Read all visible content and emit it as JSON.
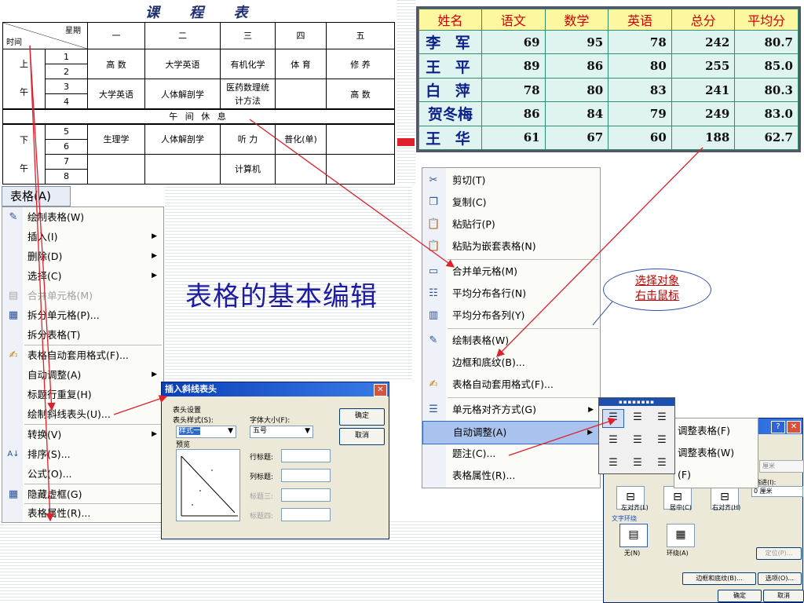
{
  "schedule": {
    "title": "课 程 表",
    "corner_top": "星期",
    "corner_bottom": "时间",
    "days": [
      "一",
      "二",
      "三",
      "四",
      "五"
    ],
    "morning_label": [
      "上",
      "午"
    ],
    "afternoon_label": [
      "下",
      "午"
    ],
    "periods": [
      "1",
      "2",
      "3",
      "4",
      "5",
      "6",
      "7",
      "8"
    ],
    "morning_rows": [
      [
        "高 数",
        "大学英语",
        "有机化学",
        "体 育",
        "修 养"
      ],
      [
        "大学英语",
        "人体解剖学",
        "医药数理统计方法",
        "",
        "高 数"
      ]
    ],
    "break_label": "午 间 休 息",
    "afternoon_rows": [
      [
        "生理学",
        "人体解剖学",
        "听 力",
        "普化(单)",
        ""
      ],
      [
        "",
        "",
        "计算机",
        "",
        ""
      ]
    ]
  },
  "scores": {
    "headers": [
      "姓名",
      "语文",
      "数学",
      "英语",
      "总分",
      "平均分"
    ],
    "rows": [
      [
        "李 军",
        "69",
        "95",
        "78",
        "242",
        "80.7"
      ],
      [
        "王 平",
        "89",
        "86",
        "80",
        "255",
        "85.0"
      ],
      [
        "白 萍",
        "78",
        "80",
        "83",
        "241",
        "80.3"
      ],
      [
        "贺冬梅",
        "86",
        "84",
        "79",
        "249",
        "83.0"
      ],
      [
        "王 华",
        "61",
        "67",
        "60",
        "188",
        "62.7"
      ]
    ]
  },
  "table_menu": {
    "title": "表格(A)",
    "items": [
      {
        "label": "绘制表格(W)",
        "icon": "pencil-table-icon",
        "disabled": false,
        "submenu": false
      },
      {
        "label": "插入(I)",
        "icon": "",
        "disabled": false,
        "submenu": true
      },
      {
        "label": "删除(D)",
        "icon": "",
        "disabled": false,
        "submenu": true
      },
      {
        "label": "选择(C)",
        "icon": "",
        "disabled": false,
        "submenu": true
      },
      {
        "label": "合并单元格(M)",
        "icon": "merge-cells-icon",
        "disabled": true,
        "submenu": false
      },
      {
        "label": "拆分单元格(P)...",
        "icon": "split-cells-icon",
        "disabled": false,
        "submenu": false
      },
      {
        "label": "拆分表格(T)",
        "icon": "",
        "disabled": false,
        "submenu": false
      },
      {
        "label": "表格自动套用格式(F)...",
        "icon": "autoformat-icon",
        "disabled": false,
        "submenu": false
      },
      {
        "label": "自动调整(A)",
        "icon": "",
        "disabled": false,
        "submenu": true
      },
      {
        "label": "标题行重复(H)",
        "icon": "",
        "disabled": false,
        "submenu": false
      },
      {
        "label": "绘制斜线表头(U)...",
        "icon": "",
        "disabled": false,
        "submenu": false
      },
      {
        "label": "转换(V)",
        "icon": "",
        "disabled": false,
        "submenu": true
      },
      {
        "label": "排序(S)...",
        "icon": "sort-az-icon",
        "disabled": false,
        "submenu": false
      },
      {
        "label": "公式(O)...",
        "icon": "",
        "disabled": false,
        "submenu": false
      },
      {
        "label": "隐藏虚框(G)",
        "icon": "gridlines-icon",
        "disabled": false,
        "submenu": false
      },
      {
        "label": "表格属性(R)...",
        "icon": "",
        "disabled": false,
        "submenu": false
      }
    ]
  },
  "big_title": "表格的基本编辑",
  "diag_dialog": {
    "title": "插入斜线表头",
    "close": "✕",
    "group_label": "表头设置",
    "style_label": "表头样式(S):",
    "style_value": "样式一",
    "font_label": "字体大小(F):",
    "font_value": "五号",
    "preview_label": "预览",
    "row_title": "行标题:",
    "col_title": "列标题:",
    "title3": "标题三:",
    "title4": "标题四:",
    "ok": "确定",
    "cancel": "取消"
  },
  "context_menu": {
    "items": [
      {
        "label": "剪切(T)",
        "icon": "scissors-icon",
        "hl": false
      },
      {
        "label": "复制(C)",
        "icon": "copy-icon",
        "hl": false
      },
      {
        "label": "粘贴行(P)",
        "icon": "paste-icon",
        "hl": false
      },
      {
        "label": "粘贴为嵌套表格(N)",
        "icon": "paste-nested-icon",
        "hl": false
      },
      {
        "label": "合并单元格(M)",
        "icon": "merge-cells-icon",
        "hl": false
      },
      {
        "label": "平均分布各行(N)",
        "icon": "distribute-rows-icon",
        "hl": false
      },
      {
        "label": "平均分布各列(Y)",
        "icon": "distribute-cols-icon",
        "hl": false
      },
      {
        "label": "绘制表格(W)",
        "icon": "pencil-table-icon",
        "hl": false
      },
      {
        "label": "边框和底纹(B)...",
        "icon": "",
        "hl": false
      },
      {
        "label": "表格自动套用格式(F)...",
        "icon": "autoformat-icon",
        "hl": false
      },
      {
        "label": "单元格对齐方式(G)",
        "icon": "cell-align-icon",
        "hl": false
      },
      {
        "label": "自动调整(A)",
        "icon": "",
        "hl": true
      },
      {
        "label": "题注(C)...",
        "icon": "",
        "hl": false
      },
      {
        "label": "表格属性(R)...",
        "icon": "",
        "hl": false
      }
    ]
  },
  "callout": [
    "选择对象",
    "右击鼠标"
  ],
  "autofit_submenu": [
    "调整表格(F)",
    "调整表格(W)",
    "(F)"
  ],
  "table_props": {
    "help": "?",
    "close": "✕",
    "unit": "厘米",
    "indent_label": "缩进(I):",
    "indent_value": "0 厘米",
    "align_left": "左对齐(L)",
    "align_center": "居中(C)",
    "align_right": "右对齐(H)",
    "wrap_label": "文字环绕",
    "wrap_none": "无(N)",
    "wrap_around": "环绕(A)",
    "position_btn": "定位(P)...",
    "borders_btn": "边框和底纹(B)...",
    "options_btn": "选项(O)...",
    "ok": "确定",
    "cancel": "取消"
  },
  "colors": {
    "title_blue": "#1c1ca0",
    "score_border": "#2f8f6f",
    "score_header_bg": "#fdf7a0",
    "score_header_text": "#d60000",
    "score_name_text": "#0b1f8a",
    "arrow_red": "#e0202a",
    "menu_highlight": "#a9c3ee"
  }
}
